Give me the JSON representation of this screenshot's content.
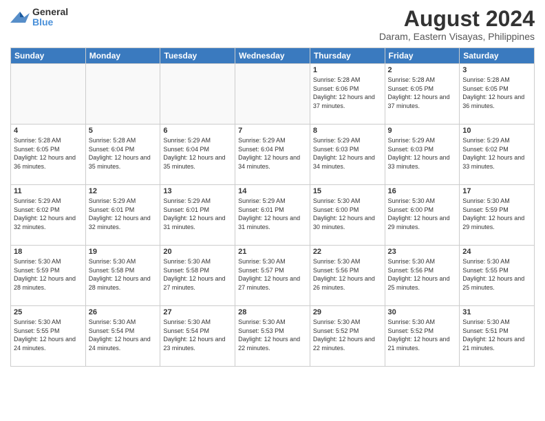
{
  "logo": {
    "general": "General",
    "blue": "Blue"
  },
  "title": "August 2024",
  "subtitle": "Daram, Eastern Visayas, Philippines",
  "weekdays": [
    "Sunday",
    "Monday",
    "Tuesday",
    "Wednesday",
    "Thursday",
    "Friday",
    "Saturday"
  ],
  "weeks": [
    [
      {
        "day": "",
        "info": ""
      },
      {
        "day": "",
        "info": ""
      },
      {
        "day": "",
        "info": ""
      },
      {
        "day": "",
        "info": ""
      },
      {
        "day": "1",
        "info": "Sunrise: 5:28 AM\nSunset: 6:06 PM\nDaylight: 12 hours\nand 37 minutes."
      },
      {
        "day": "2",
        "info": "Sunrise: 5:28 AM\nSunset: 6:05 PM\nDaylight: 12 hours\nand 37 minutes."
      },
      {
        "day": "3",
        "info": "Sunrise: 5:28 AM\nSunset: 6:05 PM\nDaylight: 12 hours\nand 36 minutes."
      }
    ],
    [
      {
        "day": "4",
        "info": "Sunrise: 5:28 AM\nSunset: 6:05 PM\nDaylight: 12 hours\nand 36 minutes."
      },
      {
        "day": "5",
        "info": "Sunrise: 5:28 AM\nSunset: 6:04 PM\nDaylight: 12 hours\nand 35 minutes."
      },
      {
        "day": "6",
        "info": "Sunrise: 5:29 AM\nSunset: 6:04 PM\nDaylight: 12 hours\nand 35 minutes."
      },
      {
        "day": "7",
        "info": "Sunrise: 5:29 AM\nSunset: 6:04 PM\nDaylight: 12 hours\nand 34 minutes."
      },
      {
        "day": "8",
        "info": "Sunrise: 5:29 AM\nSunset: 6:03 PM\nDaylight: 12 hours\nand 34 minutes."
      },
      {
        "day": "9",
        "info": "Sunrise: 5:29 AM\nSunset: 6:03 PM\nDaylight: 12 hours\nand 33 minutes."
      },
      {
        "day": "10",
        "info": "Sunrise: 5:29 AM\nSunset: 6:02 PM\nDaylight: 12 hours\nand 33 minutes."
      }
    ],
    [
      {
        "day": "11",
        "info": "Sunrise: 5:29 AM\nSunset: 6:02 PM\nDaylight: 12 hours\nand 32 minutes."
      },
      {
        "day": "12",
        "info": "Sunrise: 5:29 AM\nSunset: 6:01 PM\nDaylight: 12 hours\nand 32 minutes."
      },
      {
        "day": "13",
        "info": "Sunrise: 5:29 AM\nSunset: 6:01 PM\nDaylight: 12 hours\nand 31 minutes."
      },
      {
        "day": "14",
        "info": "Sunrise: 5:29 AM\nSunset: 6:01 PM\nDaylight: 12 hours\nand 31 minutes."
      },
      {
        "day": "15",
        "info": "Sunrise: 5:30 AM\nSunset: 6:00 PM\nDaylight: 12 hours\nand 30 minutes."
      },
      {
        "day": "16",
        "info": "Sunrise: 5:30 AM\nSunset: 6:00 PM\nDaylight: 12 hours\nand 29 minutes."
      },
      {
        "day": "17",
        "info": "Sunrise: 5:30 AM\nSunset: 5:59 PM\nDaylight: 12 hours\nand 29 minutes."
      }
    ],
    [
      {
        "day": "18",
        "info": "Sunrise: 5:30 AM\nSunset: 5:59 PM\nDaylight: 12 hours\nand 28 minutes."
      },
      {
        "day": "19",
        "info": "Sunrise: 5:30 AM\nSunset: 5:58 PM\nDaylight: 12 hours\nand 28 minutes."
      },
      {
        "day": "20",
        "info": "Sunrise: 5:30 AM\nSunset: 5:58 PM\nDaylight: 12 hours\nand 27 minutes."
      },
      {
        "day": "21",
        "info": "Sunrise: 5:30 AM\nSunset: 5:57 PM\nDaylight: 12 hours\nand 27 minutes."
      },
      {
        "day": "22",
        "info": "Sunrise: 5:30 AM\nSunset: 5:56 PM\nDaylight: 12 hours\nand 26 minutes."
      },
      {
        "day": "23",
        "info": "Sunrise: 5:30 AM\nSunset: 5:56 PM\nDaylight: 12 hours\nand 25 minutes."
      },
      {
        "day": "24",
        "info": "Sunrise: 5:30 AM\nSunset: 5:55 PM\nDaylight: 12 hours\nand 25 minutes."
      }
    ],
    [
      {
        "day": "25",
        "info": "Sunrise: 5:30 AM\nSunset: 5:55 PM\nDaylight: 12 hours\nand 24 minutes."
      },
      {
        "day": "26",
        "info": "Sunrise: 5:30 AM\nSunset: 5:54 PM\nDaylight: 12 hours\nand 24 minutes."
      },
      {
        "day": "27",
        "info": "Sunrise: 5:30 AM\nSunset: 5:54 PM\nDaylight: 12 hours\nand 23 minutes."
      },
      {
        "day": "28",
        "info": "Sunrise: 5:30 AM\nSunset: 5:53 PM\nDaylight: 12 hours\nand 22 minutes."
      },
      {
        "day": "29",
        "info": "Sunrise: 5:30 AM\nSunset: 5:52 PM\nDaylight: 12 hours\nand 22 minutes."
      },
      {
        "day": "30",
        "info": "Sunrise: 5:30 AM\nSunset: 5:52 PM\nDaylight: 12 hours\nand 21 minutes."
      },
      {
        "day": "31",
        "info": "Sunrise: 5:30 AM\nSunset: 5:51 PM\nDaylight: 12 hours\nand 21 minutes."
      }
    ]
  ]
}
